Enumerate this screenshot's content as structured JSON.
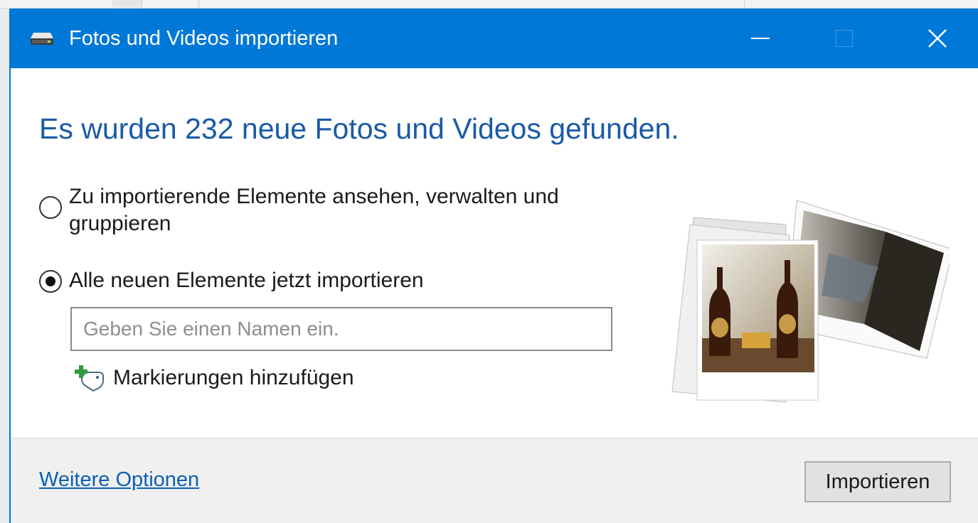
{
  "window": {
    "title": "Fotos und Videos importieren",
    "accent_color": "#0078d7",
    "icon": "drive-icon",
    "controls": [
      "minimize-icon",
      "maximize-icon",
      "close-icon"
    ],
    "close_glyph": "✕"
  },
  "main": {
    "heading": "Es wurden 232 neue Fotos und Videos gefunden.",
    "options": [
      {
        "label": "Zu importierende Elemente ansehen, verwalten und gruppieren",
        "selected": false
      },
      {
        "label": "Alle neuen Elemente jetzt importieren",
        "selected": true
      }
    ],
    "name_input": {
      "value": "",
      "placeholder": "Geben Sie einen Namen ein."
    },
    "add_tags_label": "Markierungen hinzufügen",
    "illustration": "photo-stack-illustration"
  },
  "footer": {
    "more_options_link": "Weitere Optionen",
    "import_button": "Importieren"
  }
}
